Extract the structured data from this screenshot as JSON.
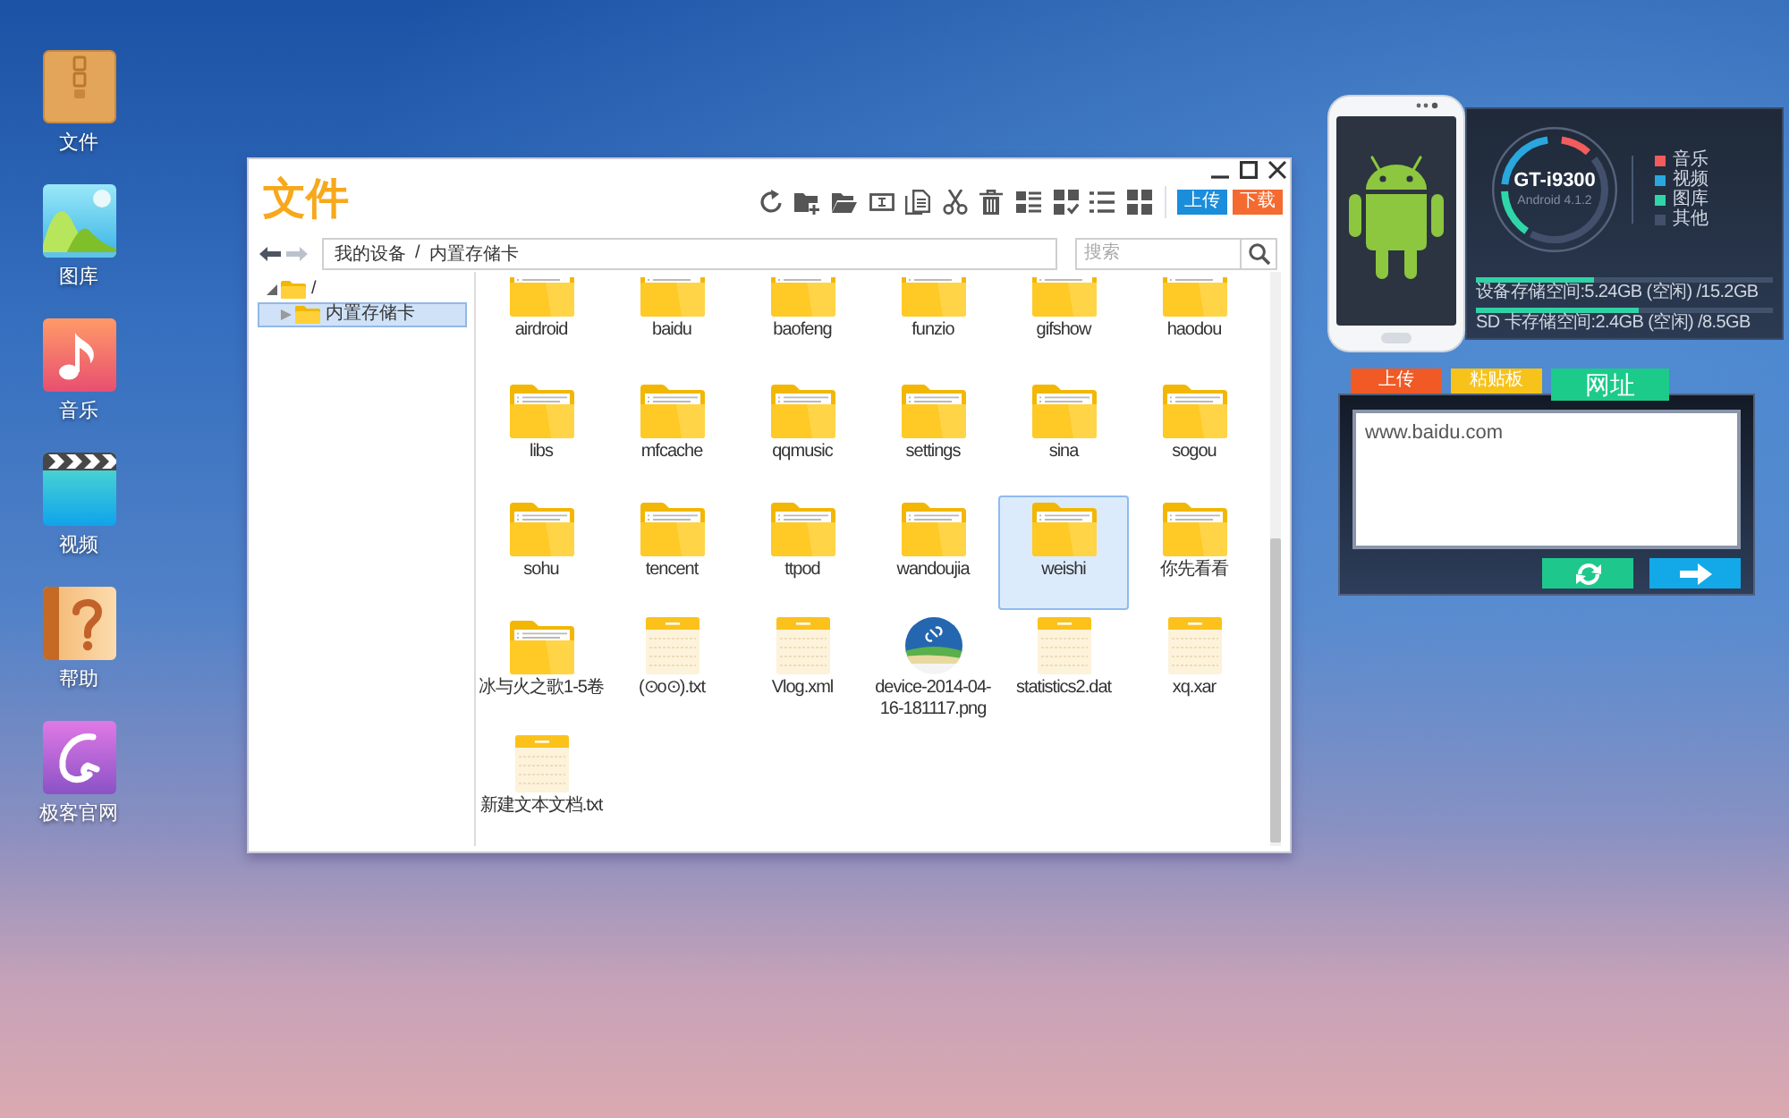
{
  "desktop": {
    "shortcuts": [
      {
        "label": "文件",
        "kind": "package"
      },
      {
        "label": "图库",
        "kind": "gallery"
      },
      {
        "label": "音乐",
        "kind": "music"
      },
      {
        "label": "视频",
        "kind": "video"
      },
      {
        "label": "帮助",
        "kind": "help"
      },
      {
        "label": "极客官网",
        "kind": "swirl"
      }
    ]
  },
  "file_window": {
    "title": "文件",
    "actions": [
      {
        "label": "上传",
        "kind": "upload"
      },
      {
        "label": "下载",
        "kind": "download"
      }
    ],
    "nav_buttons": [
      {
        "kind": "back",
        "disabled": false
      },
      {
        "kind": "forward",
        "disabled": true
      }
    ],
    "breadcrumb": {
      "items": [
        "我的设备",
        "内置存储卡"
      ],
      "separator": "/"
    },
    "search": {
      "placeholder": "搜索"
    },
    "tree": [
      {
        "label": "/",
        "expanded": true,
        "selected": false,
        "children": [
          {
            "label": "内置存储卡",
            "expanded": false,
            "selected": true
          }
        ]
      }
    ],
    "items": [
      {
        "name": "airdroid",
        "kind": "folder",
        "selected": false
      },
      {
        "name": "baidu",
        "kind": "folder",
        "selected": false
      },
      {
        "name": "baofeng",
        "kind": "folder",
        "selected": false
      },
      {
        "name": "funzio",
        "kind": "folder",
        "selected": false
      },
      {
        "name": "gifshow",
        "kind": "folder",
        "selected": false
      },
      {
        "name": "haodou",
        "kind": "folder",
        "selected": false
      },
      {
        "name": "libs",
        "kind": "folder",
        "selected": false
      },
      {
        "name": "mfcache",
        "kind": "folder",
        "selected": false
      },
      {
        "name": "qqmusic",
        "kind": "folder",
        "selected": false
      },
      {
        "name": "settings",
        "kind": "folder",
        "selected": false
      },
      {
        "name": "sina",
        "kind": "folder",
        "selected": false
      },
      {
        "name": "sogou",
        "kind": "folder",
        "selected": false
      },
      {
        "name": "sohu",
        "kind": "folder",
        "selected": false
      },
      {
        "name": "tencent",
        "kind": "folder",
        "selected": false
      },
      {
        "name": "ttpod",
        "kind": "folder",
        "selected": false
      },
      {
        "name": "wandoujia",
        "kind": "folder",
        "selected": false
      },
      {
        "name": "weishi",
        "kind": "folder",
        "selected": true
      },
      {
        "name": "你先看看",
        "kind": "folder",
        "selected": false
      },
      {
        "name": "冰与火之歌1-5卷",
        "kind": "folder",
        "selected": false
      },
      {
        "name": "(⊙o⊙).txt",
        "kind": "text",
        "selected": false
      },
      {
        "name": "Vlog.xml",
        "kind": "text",
        "selected": false
      },
      {
        "name": "device-2014-04-16-181117.png",
        "kind": "image",
        "selected": false
      },
      {
        "name": "statistics2.dat",
        "kind": "text",
        "selected": false
      },
      {
        "name": "xq.xar",
        "kind": "text",
        "selected": false
      },
      {
        "name": "新建文本文档.txt",
        "kind": "text",
        "selected": false
      }
    ]
  },
  "device_panel": {
    "model": "GT-i9300",
    "os": "Android 4.1.2",
    "legend": [
      {
        "label": "音乐",
        "color": "#f25c5c"
      },
      {
        "label": "视频",
        "color": "#2aa7df"
      },
      {
        "label": "图库",
        "color": "#2fd6a8"
      },
      {
        "label": "其他",
        "color": "#42506b"
      }
    ],
    "storage": [
      {
        "text": "设备存储空间:5.24GB (空闲) /15.2GB",
        "level": 0.4
      },
      {
        "text": "SD 卡存储空间:2.4GB (空闲) /8.5GB",
        "level": 0.55
      }
    ]
  },
  "clipboard_panel": {
    "tabs": [
      {
        "label": "上传",
        "color": "#f15a24",
        "selected": false
      },
      {
        "label": "粘贴板",
        "color": "#f7c31a",
        "selected": false
      },
      {
        "label": "网址",
        "color": "#1ccb8a",
        "selected": true
      }
    ],
    "value": "www.baidu.com"
  }
}
